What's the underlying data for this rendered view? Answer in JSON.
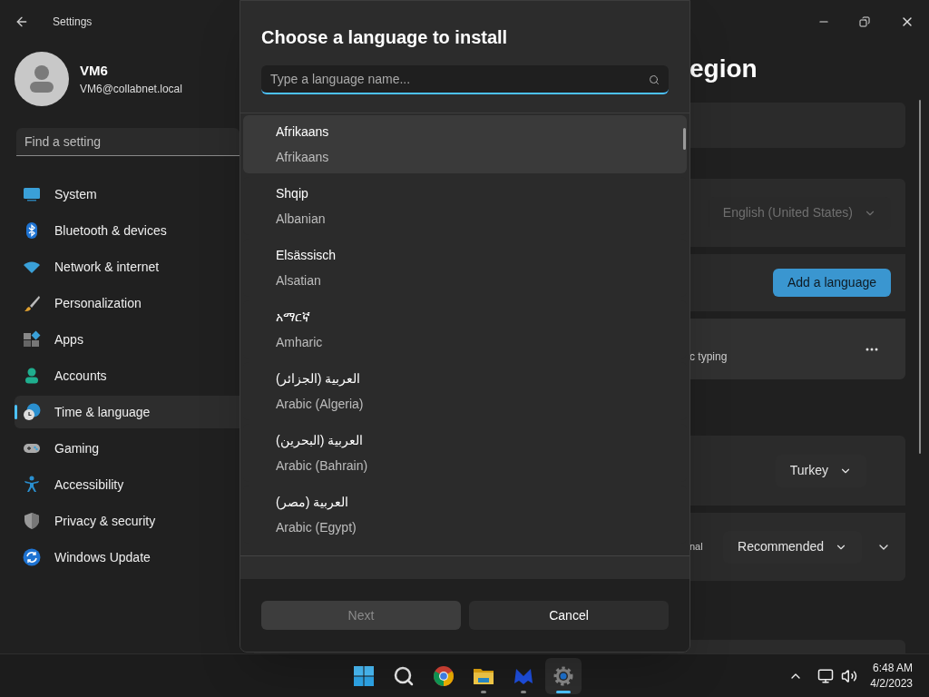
{
  "window": {
    "title": "Settings"
  },
  "profile": {
    "name": "VM6",
    "email": "VM6@collabnet.local"
  },
  "search": {
    "placeholder": "Find a setting"
  },
  "nav": [
    {
      "label": "System",
      "kind": "system",
      "selected": false
    },
    {
      "label": "Bluetooth & devices",
      "kind": "bluetooth",
      "selected": false
    },
    {
      "label": "Network & internet",
      "kind": "network",
      "selected": false
    },
    {
      "label": "Personalization",
      "kind": "brush",
      "selected": false
    },
    {
      "label": "Apps",
      "kind": "apps",
      "selected": false
    },
    {
      "label": "Accounts",
      "kind": "accounts",
      "selected": false
    },
    {
      "label": "Time & language",
      "kind": "time",
      "selected": true
    },
    {
      "label": "Gaming",
      "kind": "gaming",
      "selected": false
    },
    {
      "label": "Accessibility",
      "kind": "accessibility",
      "selected": false
    },
    {
      "label": "Privacy & security",
      "kind": "privacy",
      "selected": false
    },
    {
      "label": "Windows Update",
      "kind": "update",
      "selected": false
    }
  ],
  "page": {
    "title": "egion",
    "groups": [
      {
        "cards": [
          {
            "kind": "blank"
          }
        ]
      },
      {
        "cards": [
          {
            "kind": "dropdown",
            "value": "English (United States)",
            "disabled": true
          },
          {
            "kind": "button",
            "label": "Add a language"
          },
          {
            "kind": "language",
            "caption": "c typing"
          }
        ]
      },
      {
        "cards": [
          {
            "kind": "region",
            "value": "Turkey"
          },
          {
            "kind": "regional",
            "caption": "nal",
            "value": "Recommended"
          }
        ]
      },
      {
        "cards": [
          {
            "kind": "blank"
          }
        ]
      }
    ]
  },
  "dialog": {
    "title": "Choose a language to install",
    "search": {
      "placeholder": "Type a language name..."
    },
    "languages": [
      {
        "native": "Afrikaans",
        "english": "Afrikaans",
        "hovered": true
      },
      {
        "native": "Shqip",
        "english": "Albanian",
        "hovered": false
      },
      {
        "native": "Elsässisch",
        "english": "Alsatian",
        "hovered": false
      },
      {
        "native": "አማርኛ",
        "english": "Amharic",
        "hovered": false
      },
      {
        "native": "العربية (الجزائر)",
        "english": "Arabic (Algeria)",
        "hovered": false
      },
      {
        "native": "العربية (البحرين)",
        "english": "Arabic (Bahrain)",
        "hovered": false
      },
      {
        "native": "العربية (مصر)",
        "english": "Arabic (Egypt)",
        "hovered": false
      }
    ],
    "buttons": [
      {
        "label": "Next",
        "disabled": true
      },
      {
        "label": "Cancel",
        "disabled": false
      }
    ]
  },
  "taskbar": {
    "apps": [
      {
        "kind": "start",
        "active": false,
        "running": false
      },
      {
        "kind": "search",
        "active": false,
        "running": false
      },
      {
        "kind": "chrome",
        "active": false,
        "running": false
      },
      {
        "kind": "folder",
        "active": false,
        "running": true
      },
      {
        "kind": "malware",
        "active": false,
        "running": true
      },
      {
        "kind": "gear",
        "active": true,
        "running": true
      }
    ],
    "clock": {
      "time": "6:48 AM",
      "date": "4/2/2023"
    }
  }
}
